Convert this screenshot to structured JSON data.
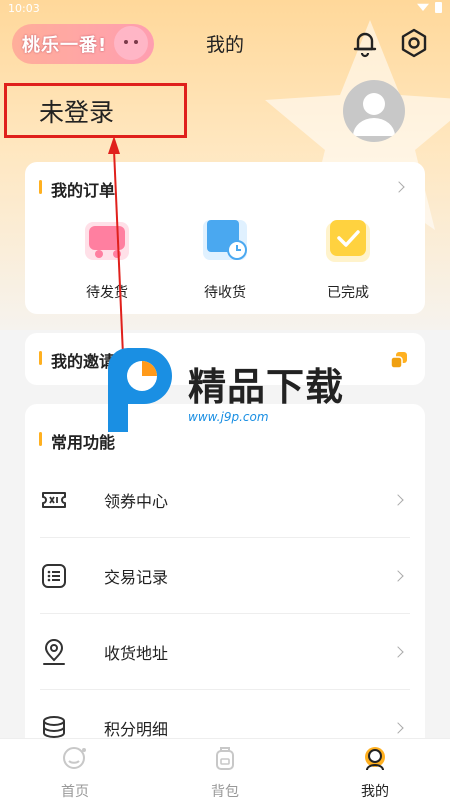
{
  "status_bar": {
    "time": "10:03"
  },
  "header": {
    "logo_text": "桃乐一番!",
    "title": "我的"
  },
  "user": {
    "login_status": "未登录"
  },
  "orders": {
    "title": "我的订单",
    "items": [
      {
        "label": "待发货",
        "icon": "box-truck-icon"
      },
      {
        "label": "待收货",
        "icon": "package-clock-icon"
      },
      {
        "label": "已完成",
        "icon": "check-box-icon"
      }
    ]
  },
  "invite": {
    "title": "我的邀请码："
  },
  "functions": {
    "title": "常用功能",
    "items": [
      {
        "label": "领券中心",
        "icon": "coupon-icon"
      },
      {
        "label": "交易记录",
        "icon": "list-icon"
      },
      {
        "label": "收货地址",
        "icon": "location-icon"
      },
      {
        "label": "积分明细",
        "icon": "coins-icon"
      }
    ]
  },
  "watermark": {
    "text": "精品下载",
    "url": "www.j9p.com"
  },
  "tabs": [
    {
      "label": "首页",
      "icon": "home-chat-icon"
    },
    {
      "label": "背包",
      "icon": "backpack-icon"
    },
    {
      "label": "我的",
      "icon": "profile-icon",
      "active": true
    }
  ],
  "colors": {
    "accent": "#ffb020",
    "highlight_box": "#e0201c"
  }
}
